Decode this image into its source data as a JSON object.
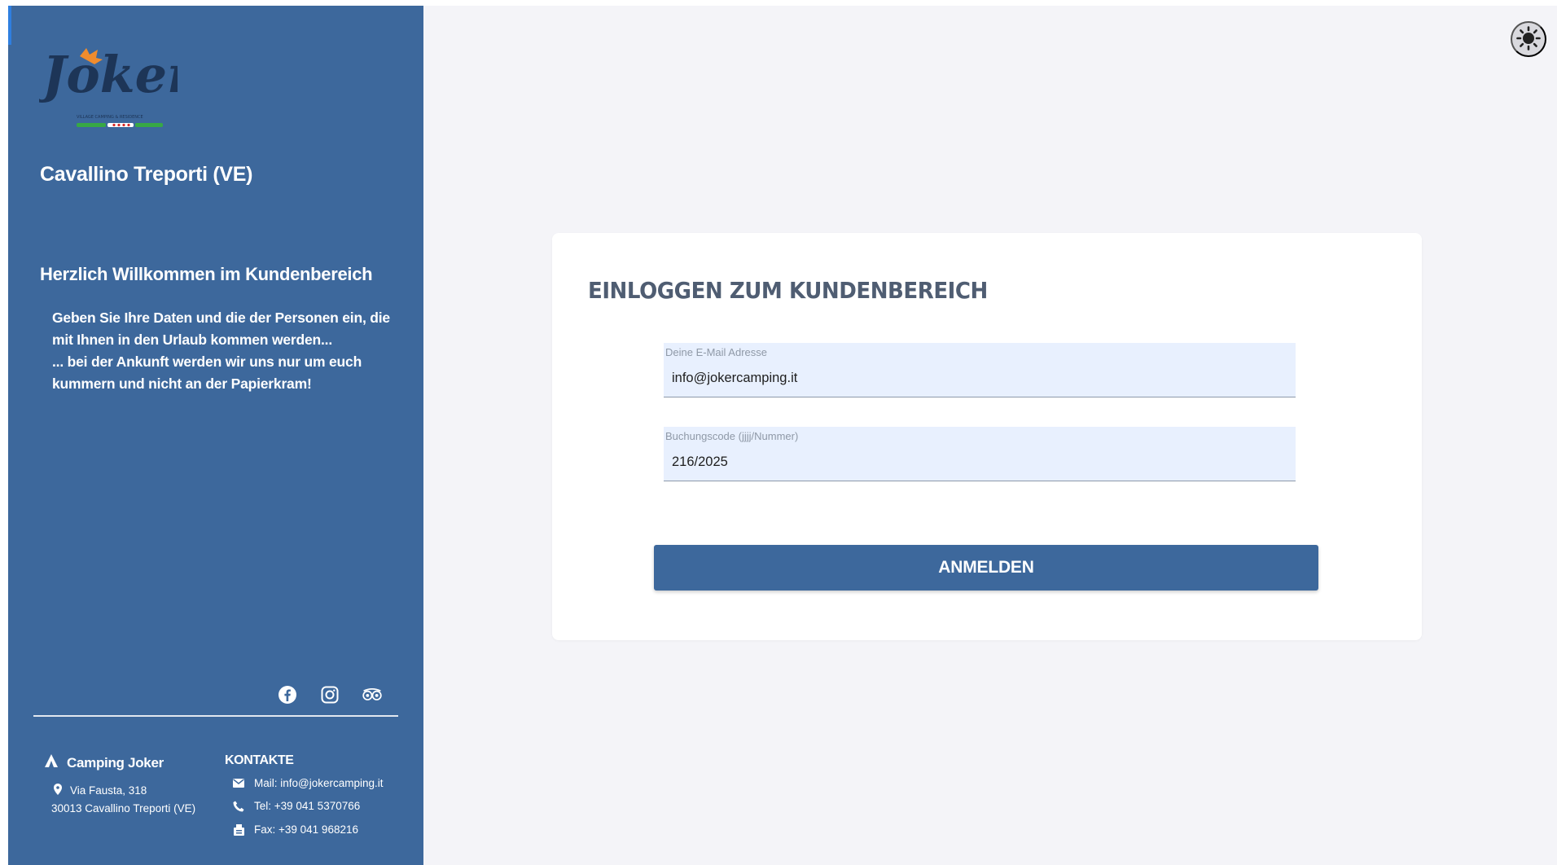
{
  "sidebar": {
    "logo_text": "Joker",
    "logo_subtext": "VILLAGE CAMPING & RESIDENCE",
    "location": "Cavallino Treporti (VE)",
    "welcome_title": "Herzlich Willkommen im Kundenbereich",
    "intro_line1": "Geben Sie Ihre Daten und die der Personen ein, die mit Ihnen in den Urlaub kommen werden...",
    "intro_line2": "... bei der Ankunft werden wir uns nur um euch kummern und nicht an der Papierkram!",
    "socials": [
      "facebook-icon",
      "instagram-icon",
      "tripadvisor-icon"
    ]
  },
  "footer": {
    "camp_name": "Camping Joker",
    "address_line1": "Via Fausta, 318",
    "address_line2": "30013 Cavallino Treporti (VE)",
    "contacts_title": "KONTAKTE",
    "mail": "Mail: info@jokercamping.it",
    "tel": "Tel: +39 041 5370766",
    "fax": "Fax: +39 041 968216"
  },
  "login": {
    "title": "EINLOGGEN ZUM KUNDENBEREICH",
    "email_label": "Deine E-Mail Adresse",
    "email_value": "info@jokercamping.it",
    "code_label": "Buchungscode (jjjj/Nummer)",
    "code_value": "216/2025",
    "submit_label": "ANMELDEN"
  },
  "colors": {
    "sidebar_bg": "#3d689c",
    "page_bg": "#f4f4f8",
    "field_bg": "#e8f0fe",
    "button_bg": "#3d689c"
  },
  "icons": {
    "theme_toggle": "sun-icon"
  }
}
